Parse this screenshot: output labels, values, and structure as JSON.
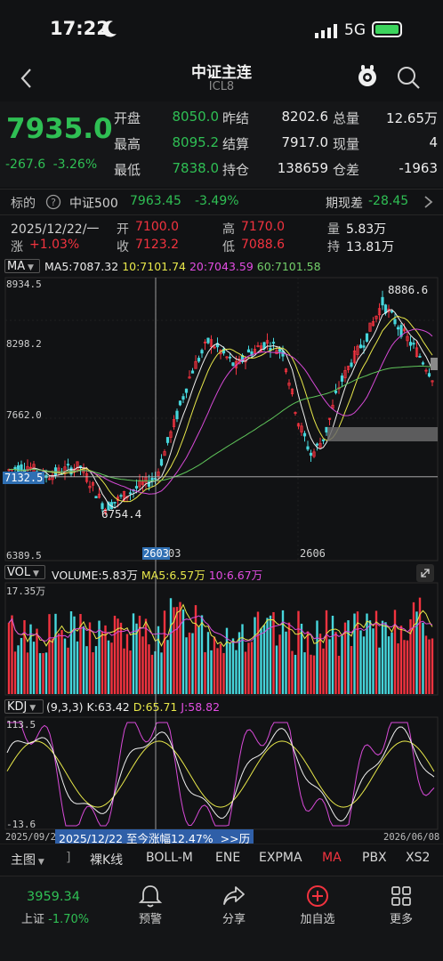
{
  "status_bar": {
    "time": "17:22",
    "network": "5G"
  },
  "header": {
    "title": "中证主连",
    "subtitle": "ICL8"
  },
  "quote": {
    "price": "7935.0",
    "change": "-267.6",
    "change_pct": "-3.26%",
    "fields": [
      {
        "label": "开盘",
        "value": "8050.0",
        "color": "green"
      },
      {
        "label": "昨结",
        "value": "8202.6",
        "color": "white"
      },
      {
        "label": "总量",
        "value": "12.65万",
        "color": "white"
      },
      {
        "label": "最高",
        "value": "8095.2",
        "color": "green"
      },
      {
        "label": "结算",
        "value": "7917.0",
        "color": "white"
      },
      {
        "label": "现量",
        "value": "4",
        "color": "white"
      },
      {
        "label": "最低",
        "value": "7838.0",
        "color": "green"
      },
      {
        "label": "持仓",
        "value": "138659",
        "color": "white"
      },
      {
        "label": "仓差",
        "value": "-1963",
        "color": "white"
      }
    ]
  },
  "underlying": {
    "label": "标的",
    "name": "中证500",
    "value": "7963.45",
    "pct": "-3.49%",
    "basis_label": "期现差",
    "basis_value": "-28.45"
  },
  "ohlc": {
    "date": "2025/12/22/一",
    "open_label": "开",
    "open": "7100.0",
    "high_label": "高",
    "high": "7170.0",
    "vol_label": "量",
    "vol": "5.83万",
    "chg_label": "涨",
    "chg": "+1.03%",
    "close_label": "收",
    "close": "7123.2",
    "low_label": "低",
    "low": "7088.6",
    "oi_label": "持",
    "oi": "13.81万"
  },
  "ma_legend": {
    "selector": "MA",
    "ma5": "MA5:7087.32",
    "ma10": "10:7101.74",
    "ma20": "20:7043.59",
    "ma60": "60:7101.58"
  },
  "main_chart": {
    "y_labels": [
      "8934.5",
      "8298.2",
      "7662.0",
      "7132.5",
      "6389.5"
    ],
    "high_mark": "8886.6",
    "low_mark": "6754.4",
    "x_cursor_label": "2603",
    "x_label_after": "03",
    "x_label_2": "2606",
    "colors": {
      "up": "#f2333f",
      "down": "#46d6dc",
      "ma5": "#f0f0f0",
      "ma10": "#e8e84a",
      "ma20": "#d84ad8",
      "ma60": "#5fc55a"
    }
  },
  "volume": {
    "selector": "VOL",
    "legend": "VOLUME:5.83万",
    "ma5": "MA5:6.57万",
    "ma10": "10:6.67万",
    "y_max": "17.35万"
  },
  "kdj": {
    "selector": "KDJ",
    "params": "(9,3,3)",
    "k": "K:63.42",
    "d": "D:65.71",
    "j": "J:58.82",
    "y_max": "113.5",
    "y_min": "-13.6",
    "date_start": "2025/09/2",
    "date_end": "2026/06/08",
    "range_text": "2025/12/22 至今涨幅12.47%",
    "range_link": ">>历"
  },
  "indicator_tabs": [
    "主图",
    "]",
    "裸K线",
    "BOLL-M",
    "ENE",
    "EXPMA",
    "MA",
    "PBX",
    "XS2"
  ],
  "active_tab": "MA",
  "bottom_bar": {
    "index_value": "3959.34",
    "index_name": "上证",
    "index_pct": "-1.70%",
    "items": [
      "预警",
      "分享",
      "加自选",
      "更多"
    ]
  }
}
